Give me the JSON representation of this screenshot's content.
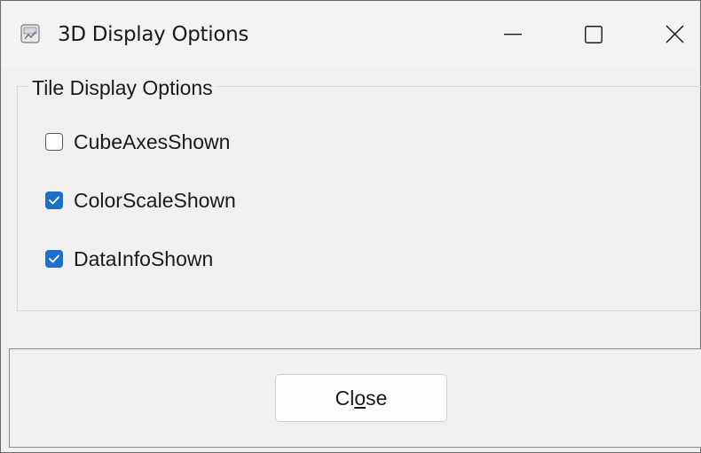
{
  "window": {
    "title": "3D Display Options",
    "icon": "app-icon",
    "controls": {
      "minimize_icon": "minimize-icon",
      "maximize_icon": "maximize-icon",
      "close_icon": "close-icon"
    }
  },
  "group": {
    "label": "Tile Display Options",
    "options": [
      {
        "label": "CubeAxesShown",
        "checked": false
      },
      {
        "label": "ColorScaleShown",
        "checked": true
      },
      {
        "label": "DataInfoShown",
        "checked": true
      }
    ]
  },
  "footer": {
    "close_button": {
      "before": "Cl",
      "mnemonic": "o",
      "after": "se"
    }
  },
  "colors": {
    "accent": "#1f6fc5",
    "background": "#f0f0f0",
    "titlebar": "#f3f3f3"
  }
}
